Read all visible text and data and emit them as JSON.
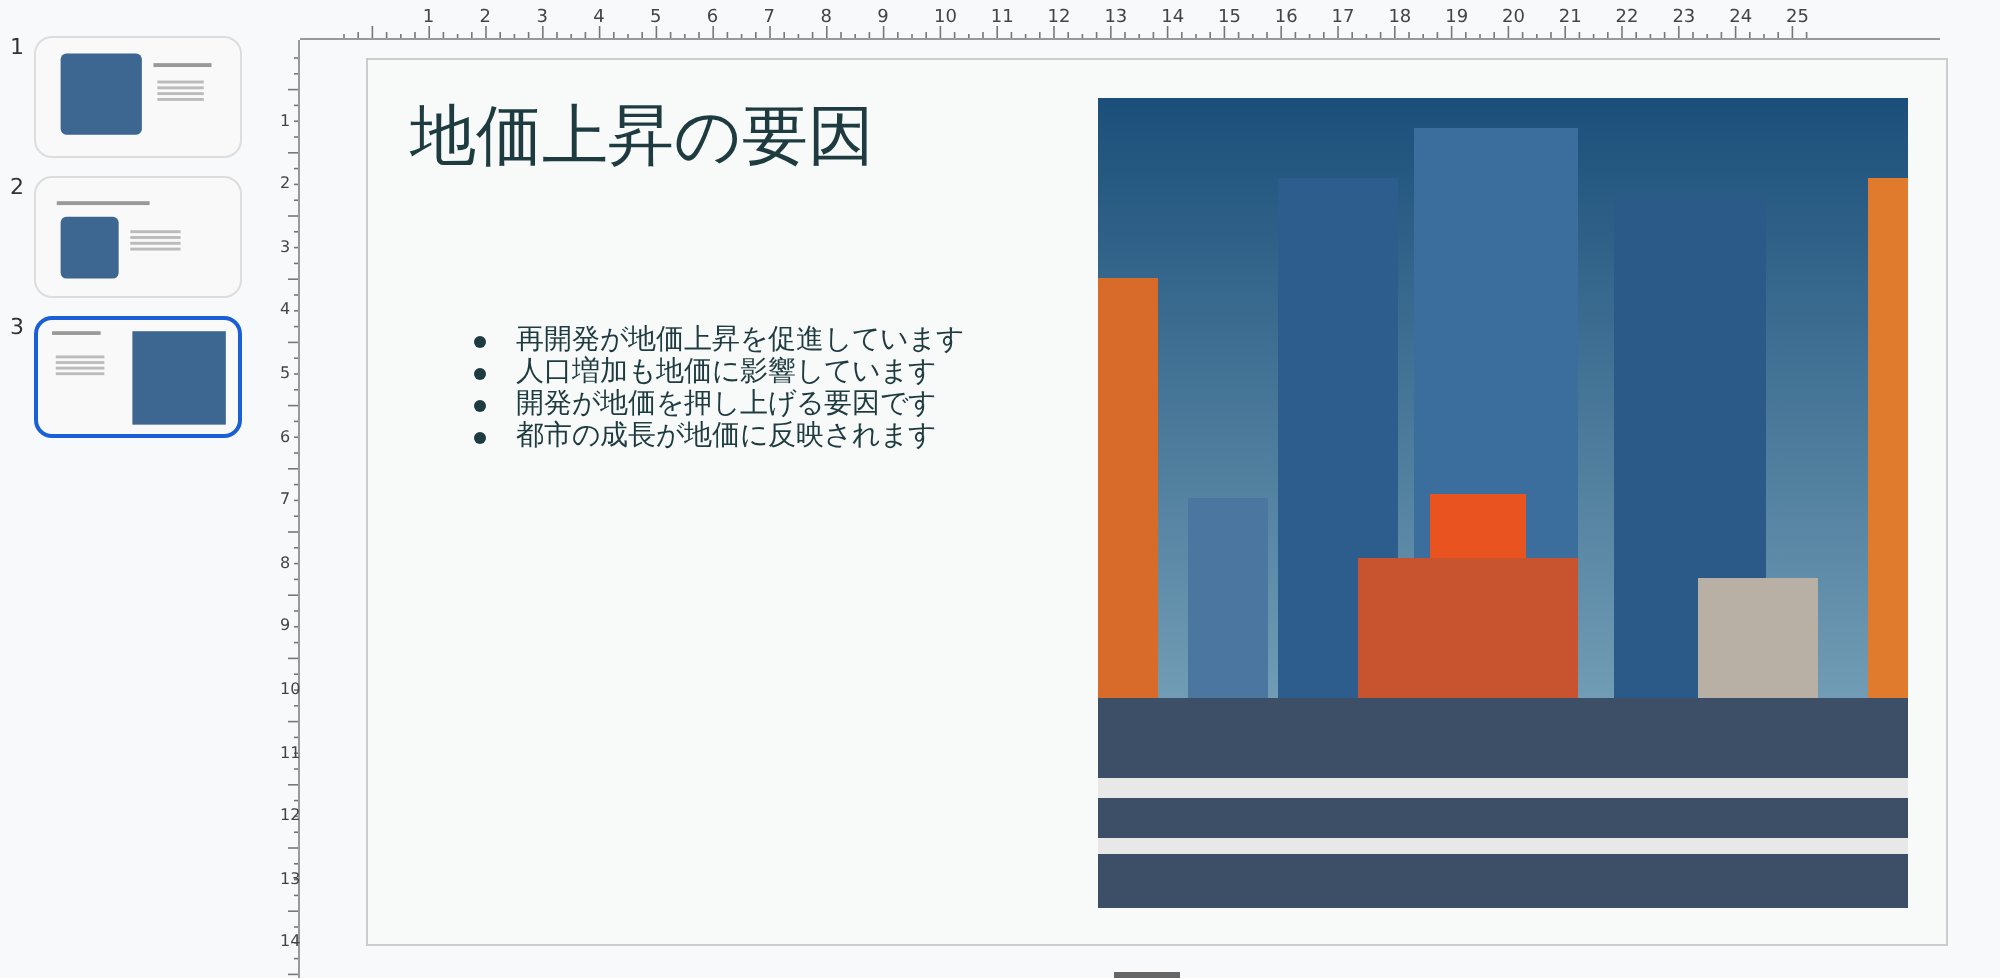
{
  "slides": [
    {
      "number": "1",
      "selected": false,
      "kind": "imageleft"
    },
    {
      "number": "2",
      "selected": false,
      "kind": "titletop"
    },
    {
      "number": "3",
      "selected": true,
      "kind": "imageright"
    }
  ],
  "ruler": {
    "horizontal": [
      "1",
      "2",
      "3",
      "4",
      "5",
      "6",
      "7",
      "8",
      "9",
      "10",
      "11",
      "12",
      "13",
      "14",
      "15",
      "16",
      "17",
      "18",
      "19",
      "20",
      "21",
      "22",
      "23",
      "24",
      "25"
    ],
    "vertical": [
      "1",
      "2",
      "3",
      "4",
      "5",
      "6",
      "7",
      "8",
      "9",
      "10",
      "11",
      "12",
      "13",
      "14"
    ]
  },
  "slide": {
    "title": "地価上昇の要因",
    "bullets": [
      "再開発が地価上昇を促進しています",
      "人口増加も地価に影響しています",
      "開発が地価を押し上げる要因です",
      "都市の成長が地価に反映されます"
    ]
  }
}
